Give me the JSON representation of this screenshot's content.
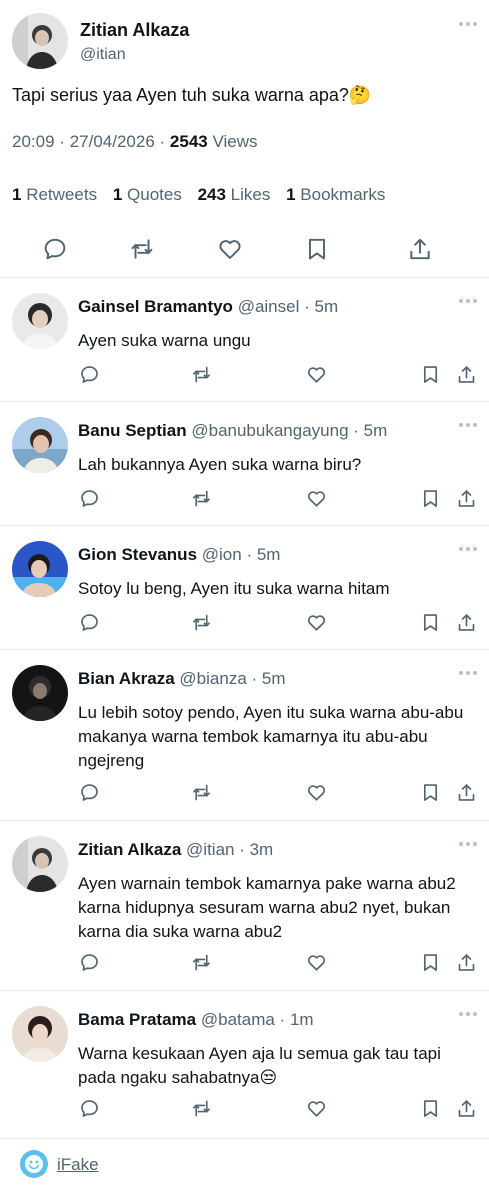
{
  "colors": {
    "text": "#0f1419",
    "secondary": "#536471",
    "divider": "#e6e9ec",
    "brand": "#5cc0ee"
  },
  "main_tweet": {
    "name": "Zitian Alkaza",
    "handle": "@itian",
    "text": "Tapi serius yaa Ayen tuh suka warna apa?",
    "emoji": "🤔",
    "time": "20:09",
    "date": "27/04/2026",
    "separator": "·",
    "views_count": "2543",
    "views_label": "Views",
    "stats": {
      "retweets_count": "1",
      "retweets_label": "Retweets",
      "quotes_count": "1",
      "quotes_label": "Quotes",
      "likes_count": "243",
      "likes_label": "Likes",
      "bookmarks_count": "1",
      "bookmarks_label": "Bookmarks"
    },
    "actions": [
      "reply-icon",
      "retweet-icon",
      "like-icon",
      "bookmark-icon",
      "share-icon"
    ]
  },
  "replies": [
    {
      "name": "Gainsel Bramantyo",
      "handle": "@ainsel",
      "time": "5m",
      "text": "Ayen suka warna ungu"
    },
    {
      "name": "Banu Septian",
      "handle": "@banubukangayung",
      "time": "5m",
      "text": "Lah bukannya Ayen suka warna biru?"
    },
    {
      "name": "Gion Stevanus",
      "handle": "@ion",
      "time": "5m",
      "text": "Sotoy lu beng, Ayen itu suka warna hitam"
    },
    {
      "name": "Bian Akraza",
      "handle": "@bianza",
      "time": "5m",
      "text": "Lu lebih sotoy pendo, Ayen itu suka warna abu-abu makanya warna tembok kamarnya itu abu-abu ngejreng"
    },
    {
      "name": "Zitian Alkaza",
      "handle": "@itian",
      "time": "3m",
      "text": "Ayen warnain tembok kamarnya pake warna abu2 karna hidupnya sesuram warna abu2 nyet, bukan karna dia suka warna abu2"
    },
    {
      "name": "Bama Pratama",
      "handle": "@batama",
      "time": "1m",
      "text": "Warna kesukaan Ayen aja lu semua gak tau tapi pada ngaku sahabatnya😒"
    }
  ],
  "footer": {
    "label": "iFake"
  }
}
